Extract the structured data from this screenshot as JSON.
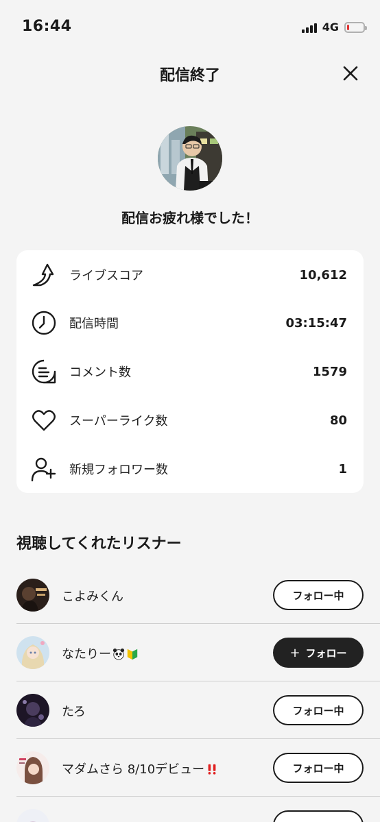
{
  "status_bar": {
    "time": "16:44",
    "network": "4G",
    "battery_level": 0.12,
    "battery_color": "#e03030"
  },
  "header": {
    "title": "配信終了",
    "close_icon": "close-icon"
  },
  "greeting": "配信お疲れ様でした！",
  "stats": [
    {
      "icon": "live-score-icon",
      "label": "ライブスコア",
      "value": "10,612"
    },
    {
      "icon": "clock-icon",
      "label": "配信時間",
      "value": "03:15:47"
    },
    {
      "icon": "comment-icon",
      "label": "コメント数",
      "value": "1579"
    },
    {
      "icon": "heart-icon",
      "label": "スーパーライク数",
      "value": "80"
    },
    {
      "icon": "add-user-icon",
      "label": "新規フォロワー数",
      "value": "1"
    }
  ],
  "listeners_section": {
    "title": "視聴してくれたリスナー",
    "items": [
      {
        "name": "こよみくん",
        "button": "フォロー中",
        "following": true
      },
      {
        "name": "なたりー",
        "button": "フォロー",
        "following": false,
        "emojis": [
          "panda-icon",
          "beginner-mark-icon"
        ]
      },
      {
        "name": "たろ",
        "button": "フォロー中",
        "following": true
      },
      {
        "name": "マダムさら 8/10デビュー",
        "button": "フォロー中",
        "following": true,
        "emojis": [
          "double-exclamation-icon"
        ]
      }
    ]
  },
  "colors": {
    "background": "#f4f4f4",
    "card": "#ffffff",
    "text": "#1a1a1a",
    "follow_button_dark": "#222222"
  }
}
